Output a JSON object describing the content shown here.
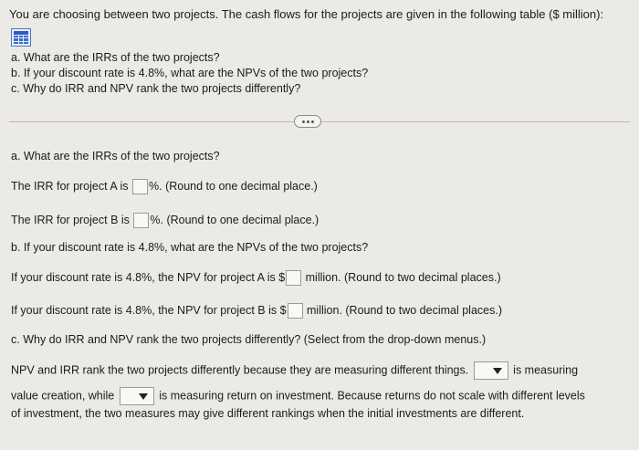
{
  "intro": "You are choosing between two projects. The cash flows for the projects are given in the following table ($ million):",
  "questions": {
    "a": "a. What are the IRRs of the two projects?",
    "b": "b. If your discount rate is 4.8%, what are the NPVs of the two projects?",
    "c": "c. Why do IRR and NPV rank the two projects differently?"
  },
  "part_a": {
    "heading": "a. What are the IRRs of the two projects?",
    "irr_a_prefix": "The IRR for project A is",
    "irr_b_prefix": "The IRR for project B is",
    "irr_suffix": "%. (Round to one decimal place.)"
  },
  "part_b": {
    "heading": "b. If your discount rate is 4.8%, what are the NPVs of the two projects?",
    "npv_a_prefix": "If your discount rate is 4.8%, the NPV for project A is $",
    "npv_b_prefix": "If your discount rate is 4.8%, the NPV for project B is $",
    "npv_suffix": "million. (Round to two decimal places.)"
  },
  "part_c": {
    "heading": "c. Why do IRR and NPV rank the two projects differently? (Select from the drop-down menus.)",
    "line1_start": "NPV and IRR rank the two projects differently because they are measuring different things.",
    "line1_end": "is measuring",
    "line2_start": "value creation, while",
    "line2_end": "is measuring return on investment. Because returns do not scale with different levels",
    "line3": "of investment, the two measures may give different rankings when the initial investments are different."
  },
  "icons": {
    "table": "table-grid-icon",
    "more": "more-dots-icon",
    "dropdown": "chevron-down-icon"
  }
}
